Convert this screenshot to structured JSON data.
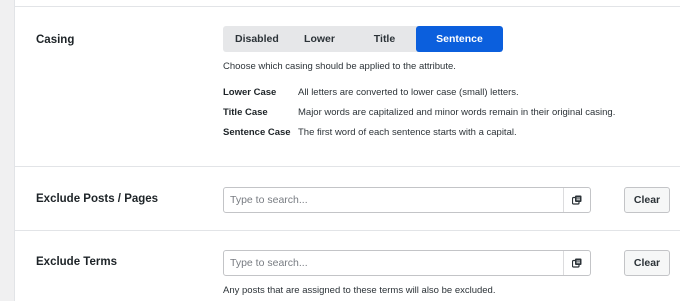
{
  "casing": {
    "label": "Casing",
    "options": [
      {
        "label": "Disabled",
        "active": false
      },
      {
        "label": "Lower Case",
        "active": false
      },
      {
        "label": "Title Case",
        "active": false
      },
      {
        "label": "Sentence Case",
        "active": true
      }
    ],
    "help": "Choose which casing should be applied to the attribute.",
    "definitions": [
      {
        "term": "Lower Case",
        "desc": "All letters are converted to lower case (small) letters."
      },
      {
        "term": "Title Case",
        "desc": "Major words are capitalized and minor words remain in their original casing."
      },
      {
        "term": "Sentence Case",
        "desc": "The first word of each sentence starts with a capital."
      }
    ]
  },
  "exclude_posts": {
    "label": "Exclude Posts / Pages",
    "placeholder": "Type to search...",
    "icon": "list-icon",
    "clear_label": "Clear"
  },
  "exclude_terms": {
    "label": "Exclude Terms",
    "placeholder": "Type to search...",
    "icon": "list-icon",
    "clear_label": "Clear",
    "help": "Any posts that are assigned to these terms will also be excluded."
  },
  "colors": {
    "accent": "#0b5fdd",
    "page_bg": "#f0f0f1",
    "panel_bg": "#ffffff"
  }
}
